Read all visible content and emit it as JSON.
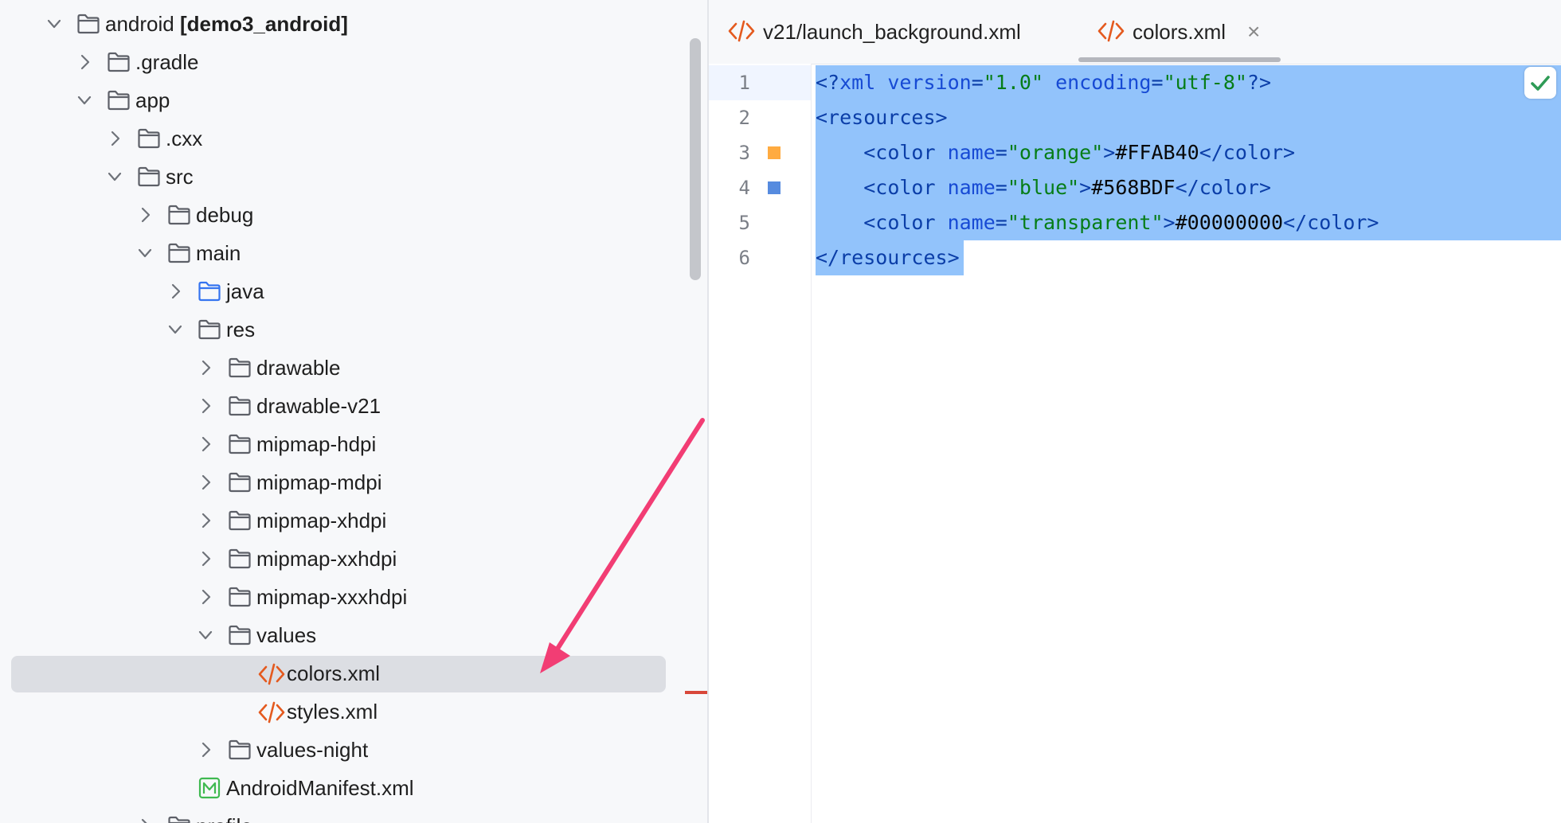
{
  "tree": {
    "items": [
      {
        "label": "android",
        "suffix": "[demo3_android]",
        "level": 1,
        "expanded": true,
        "icon": "folder-icon"
      },
      {
        "label": ".gradle",
        "level": 2,
        "expanded": false,
        "icon": "folder-icon"
      },
      {
        "label": "app",
        "level": 2,
        "expanded": true,
        "icon": "folder-icon"
      },
      {
        "label": ".cxx",
        "level": 3,
        "expanded": false,
        "icon": "folder-icon"
      },
      {
        "label": "src",
        "level": 3,
        "expanded": true,
        "icon": "folder-icon"
      },
      {
        "label": "debug",
        "level": 4,
        "expanded": false,
        "icon": "folder-icon"
      },
      {
        "label": "main",
        "level": 4,
        "expanded": true,
        "icon": "folder-icon"
      },
      {
        "label": "java",
        "level": 5,
        "expanded": false,
        "icon": "source-folder-icon"
      },
      {
        "label": "res",
        "level": 5,
        "expanded": true,
        "icon": "folder-icon"
      },
      {
        "label": "drawable",
        "level": 6,
        "expanded": false,
        "icon": "folder-icon"
      },
      {
        "label": "drawable-v21",
        "level": 6,
        "expanded": false,
        "icon": "folder-icon"
      },
      {
        "label": "mipmap-hdpi",
        "level": 6,
        "expanded": false,
        "icon": "folder-icon"
      },
      {
        "label": "mipmap-mdpi",
        "level": 6,
        "expanded": false,
        "icon": "folder-icon"
      },
      {
        "label": "mipmap-xhdpi",
        "level": 6,
        "expanded": false,
        "icon": "folder-icon"
      },
      {
        "label": "mipmap-xxhdpi",
        "level": 6,
        "expanded": false,
        "icon": "folder-icon"
      },
      {
        "label": "mipmap-xxxhdpi",
        "level": 6,
        "expanded": false,
        "icon": "folder-icon"
      },
      {
        "label": "values",
        "level": 6,
        "expanded": true,
        "icon": "folder-icon"
      },
      {
        "label": "colors.xml",
        "level": 7,
        "icon": "xml-file-icon",
        "selected": true
      },
      {
        "label": "styles.xml",
        "level": 7,
        "icon": "xml-file-icon"
      },
      {
        "label": "values-night",
        "level": 6,
        "expanded": false,
        "icon": "folder-icon"
      },
      {
        "label": "AndroidManifest.xml",
        "level": 5,
        "icon": "manifest-file-icon"
      },
      {
        "label": "profile",
        "level": 4,
        "expanded": false,
        "icon": "folder-icon"
      }
    ]
  },
  "editor": {
    "tabs": [
      {
        "label": "v21/launch_background.xml",
        "active": false
      },
      {
        "label": "colors.xml",
        "active": true,
        "close": "×"
      }
    ],
    "lines": [
      {
        "no": "1",
        "tokens": [
          [
            "tag",
            "<?"
          ],
          [
            "attr",
            "xml "
          ],
          [
            "attr",
            "version"
          ],
          [
            "tag",
            "="
          ],
          [
            "str",
            "\"1.0\""
          ],
          [
            "txt",
            " "
          ],
          [
            "attr",
            "encoding"
          ],
          [
            "tag",
            "="
          ],
          [
            "str",
            "\"utf-8\""
          ],
          [
            "tag",
            "?>"
          ]
        ]
      },
      {
        "no": "2",
        "tokens": [
          [
            "tag",
            "<resources>"
          ]
        ]
      },
      {
        "no": "3",
        "swatch": "#FFAB40",
        "tokens": [
          [
            "txt",
            "    "
          ],
          [
            "tag",
            "<color "
          ],
          [
            "attr",
            "name"
          ],
          [
            "tag",
            "="
          ],
          [
            "str",
            "\"orange\""
          ],
          [
            "tag",
            ">"
          ],
          [
            "txt",
            "#FFAB40"
          ],
          [
            "tag",
            "</color>"
          ]
        ]
      },
      {
        "no": "4",
        "swatch": "#568BDF",
        "tokens": [
          [
            "txt",
            "    "
          ],
          [
            "tag",
            "<color "
          ],
          [
            "attr",
            "name"
          ],
          [
            "tag",
            "="
          ],
          [
            "str",
            "\"blue\""
          ],
          [
            "tag",
            ">"
          ],
          [
            "txt",
            "#568BDF"
          ],
          [
            "tag",
            "</color>"
          ]
        ]
      },
      {
        "no": "5",
        "tokens": [
          [
            "txt",
            "    "
          ],
          [
            "tag",
            "<color "
          ],
          [
            "attr",
            "name"
          ],
          [
            "tag",
            "="
          ],
          [
            "str",
            "\"transparent\""
          ],
          [
            "tag",
            ">"
          ],
          [
            "txt",
            "#00000000"
          ],
          [
            "tag",
            "</color>"
          ]
        ]
      },
      {
        "no": "6",
        "tokens": [
          [
            "tag",
            "</resources>"
          ]
        ]
      }
    ]
  },
  "colors": {
    "selection": "#92c3fb",
    "accent_icon": "#e45a1f",
    "arrow": "#f23d74",
    "check": "#2e9b56"
  }
}
